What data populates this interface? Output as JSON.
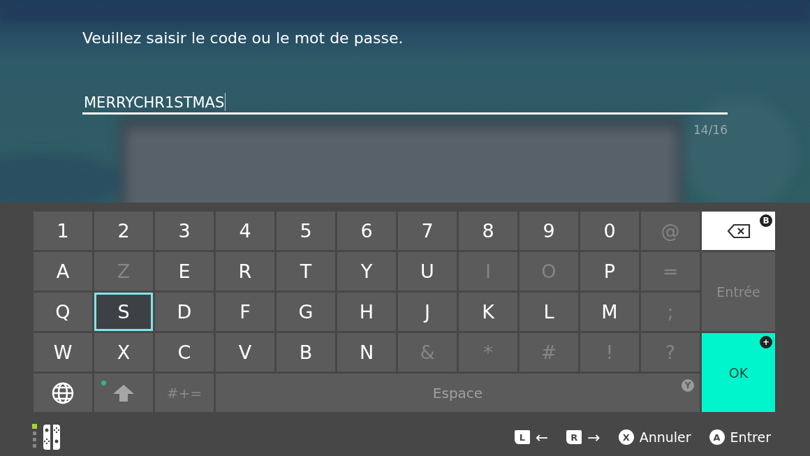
{
  "prompt": "Veuillez saisir le code ou le mot de passe.",
  "input": {
    "value": "MERRYCHR1STMAS",
    "counter": "14/16"
  },
  "keyboard": {
    "rows": [
      [
        {
          "label": "1",
          "disabled": false,
          "selected": false
        },
        {
          "label": "2",
          "disabled": false,
          "selected": false
        },
        {
          "label": "3",
          "disabled": false,
          "selected": false
        },
        {
          "label": "4",
          "disabled": false,
          "selected": false
        },
        {
          "label": "5",
          "disabled": false,
          "selected": false
        },
        {
          "label": "6",
          "disabled": false,
          "selected": false
        },
        {
          "label": "7",
          "disabled": false,
          "selected": false
        },
        {
          "label": "8",
          "disabled": false,
          "selected": false
        },
        {
          "label": "9",
          "disabled": false,
          "selected": false
        },
        {
          "label": "0",
          "disabled": false,
          "selected": false
        },
        {
          "label": "@",
          "disabled": true,
          "selected": false
        }
      ],
      [
        {
          "label": "A",
          "disabled": false,
          "selected": false
        },
        {
          "label": "Z",
          "disabled": true,
          "selected": false
        },
        {
          "label": "E",
          "disabled": false,
          "selected": false
        },
        {
          "label": "R",
          "disabled": false,
          "selected": false
        },
        {
          "label": "T",
          "disabled": false,
          "selected": false
        },
        {
          "label": "Y",
          "disabled": false,
          "selected": false
        },
        {
          "label": "U",
          "disabled": false,
          "selected": false
        },
        {
          "label": "I",
          "disabled": true,
          "selected": false
        },
        {
          "label": "O",
          "disabled": true,
          "selected": false
        },
        {
          "label": "P",
          "disabled": false,
          "selected": false
        },
        {
          "label": "=",
          "disabled": true,
          "selected": false
        }
      ],
      [
        {
          "label": "Q",
          "disabled": false,
          "selected": false
        },
        {
          "label": "S",
          "disabled": false,
          "selected": true
        },
        {
          "label": "D",
          "disabled": false,
          "selected": false
        },
        {
          "label": "F",
          "disabled": false,
          "selected": false
        },
        {
          "label": "G",
          "disabled": false,
          "selected": false
        },
        {
          "label": "H",
          "disabled": false,
          "selected": false
        },
        {
          "label": "J",
          "disabled": false,
          "selected": false
        },
        {
          "label": "K",
          "disabled": false,
          "selected": false
        },
        {
          "label": "L",
          "disabled": false,
          "selected": false
        },
        {
          "label": "M",
          "disabled": false,
          "selected": false
        },
        {
          "label": ";",
          "disabled": true,
          "selected": false
        }
      ],
      [
        {
          "label": "W",
          "disabled": false,
          "selected": false
        },
        {
          "label": "X",
          "disabled": false,
          "selected": false
        },
        {
          "label": "C",
          "disabled": false,
          "selected": false
        },
        {
          "label": "V",
          "disabled": false,
          "selected": false
        },
        {
          "label": "B",
          "disabled": false,
          "selected": false
        },
        {
          "label": "N",
          "disabled": false,
          "selected": false
        },
        {
          "label": "&",
          "disabled": true,
          "selected": false
        },
        {
          "label": "*",
          "disabled": true,
          "selected": false
        },
        {
          "label": "#",
          "disabled": true,
          "selected": false
        },
        {
          "label": "!",
          "disabled": true,
          "selected": false
        },
        {
          "label": "?",
          "disabled": true,
          "selected": false
        }
      ]
    ],
    "bottom_row": [
      {
        "kind": "globe"
      },
      {
        "kind": "shift",
        "active": true
      },
      {
        "kind": "symbols",
        "label": "#+="
      },
      {
        "kind": "space",
        "label": "Espace",
        "badge": "Y"
      }
    ],
    "backspace": {
      "badge": "B"
    },
    "enter": {
      "label": "Entrée",
      "disabled": true
    },
    "ok": {
      "label": "OK",
      "badge": "+"
    }
  },
  "footer": {
    "hints": [
      {
        "kind": "key",
        "button": "L",
        "arrow": "←"
      },
      {
        "kind": "key",
        "button": "R",
        "arrow": "→"
      },
      {
        "kind": "round",
        "button": "X",
        "label": "Annuler"
      },
      {
        "kind": "round",
        "button": "A",
        "label": "Entrer"
      }
    ]
  }
}
